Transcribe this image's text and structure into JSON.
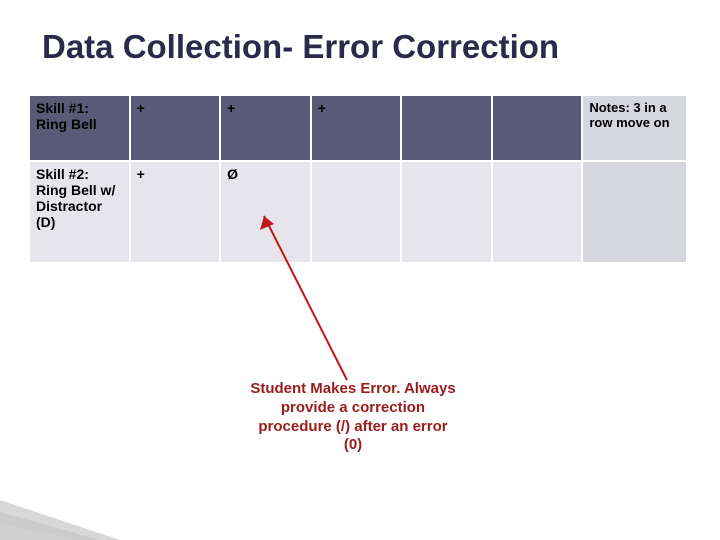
{
  "title": "Data Collection- Error Correction",
  "table": {
    "rows": [
      {
        "label": "Skill #1: Ring Bell",
        "cells": [
          "+",
          "+",
          "+",
          "",
          ""
        ],
        "note": "Notes: 3 in a row move on"
      },
      {
        "label": "Skill #2: Ring Bell w/ Distractor (D)",
        "cells": [
          "+",
          "Ø",
          "",
          "",
          ""
        ],
        "note": ""
      }
    ]
  },
  "callout": "Student Makes Error. Always provide a correction procedure (/) after an error (0)"
}
